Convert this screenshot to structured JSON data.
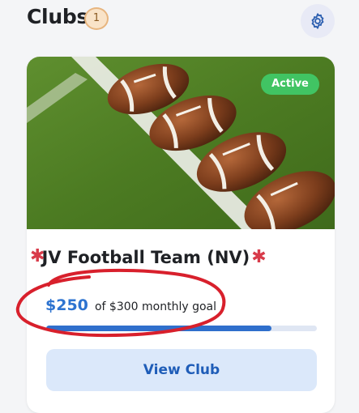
{
  "header": {
    "title": "Clubs",
    "count": "1",
    "settings_icon": "gear-icon"
  },
  "club": {
    "image_icon": "football-photo",
    "status_badge": "Active",
    "name_prefix_mark": "✱",
    "name": "JV Football Team (NV)",
    "name_suffix_mark": "✱",
    "raised": "$250",
    "goal_text": "of $300 monthly goal",
    "progress_fraction": 0.833,
    "button_label": "View Club"
  },
  "annotation": {
    "shape": "hand-drawn ellipse",
    "color": "#d8202c"
  },
  "colors": {
    "accent": "#2d73d0",
    "status_active": "#41c463",
    "button_bg": "#dbe8fa"
  }
}
